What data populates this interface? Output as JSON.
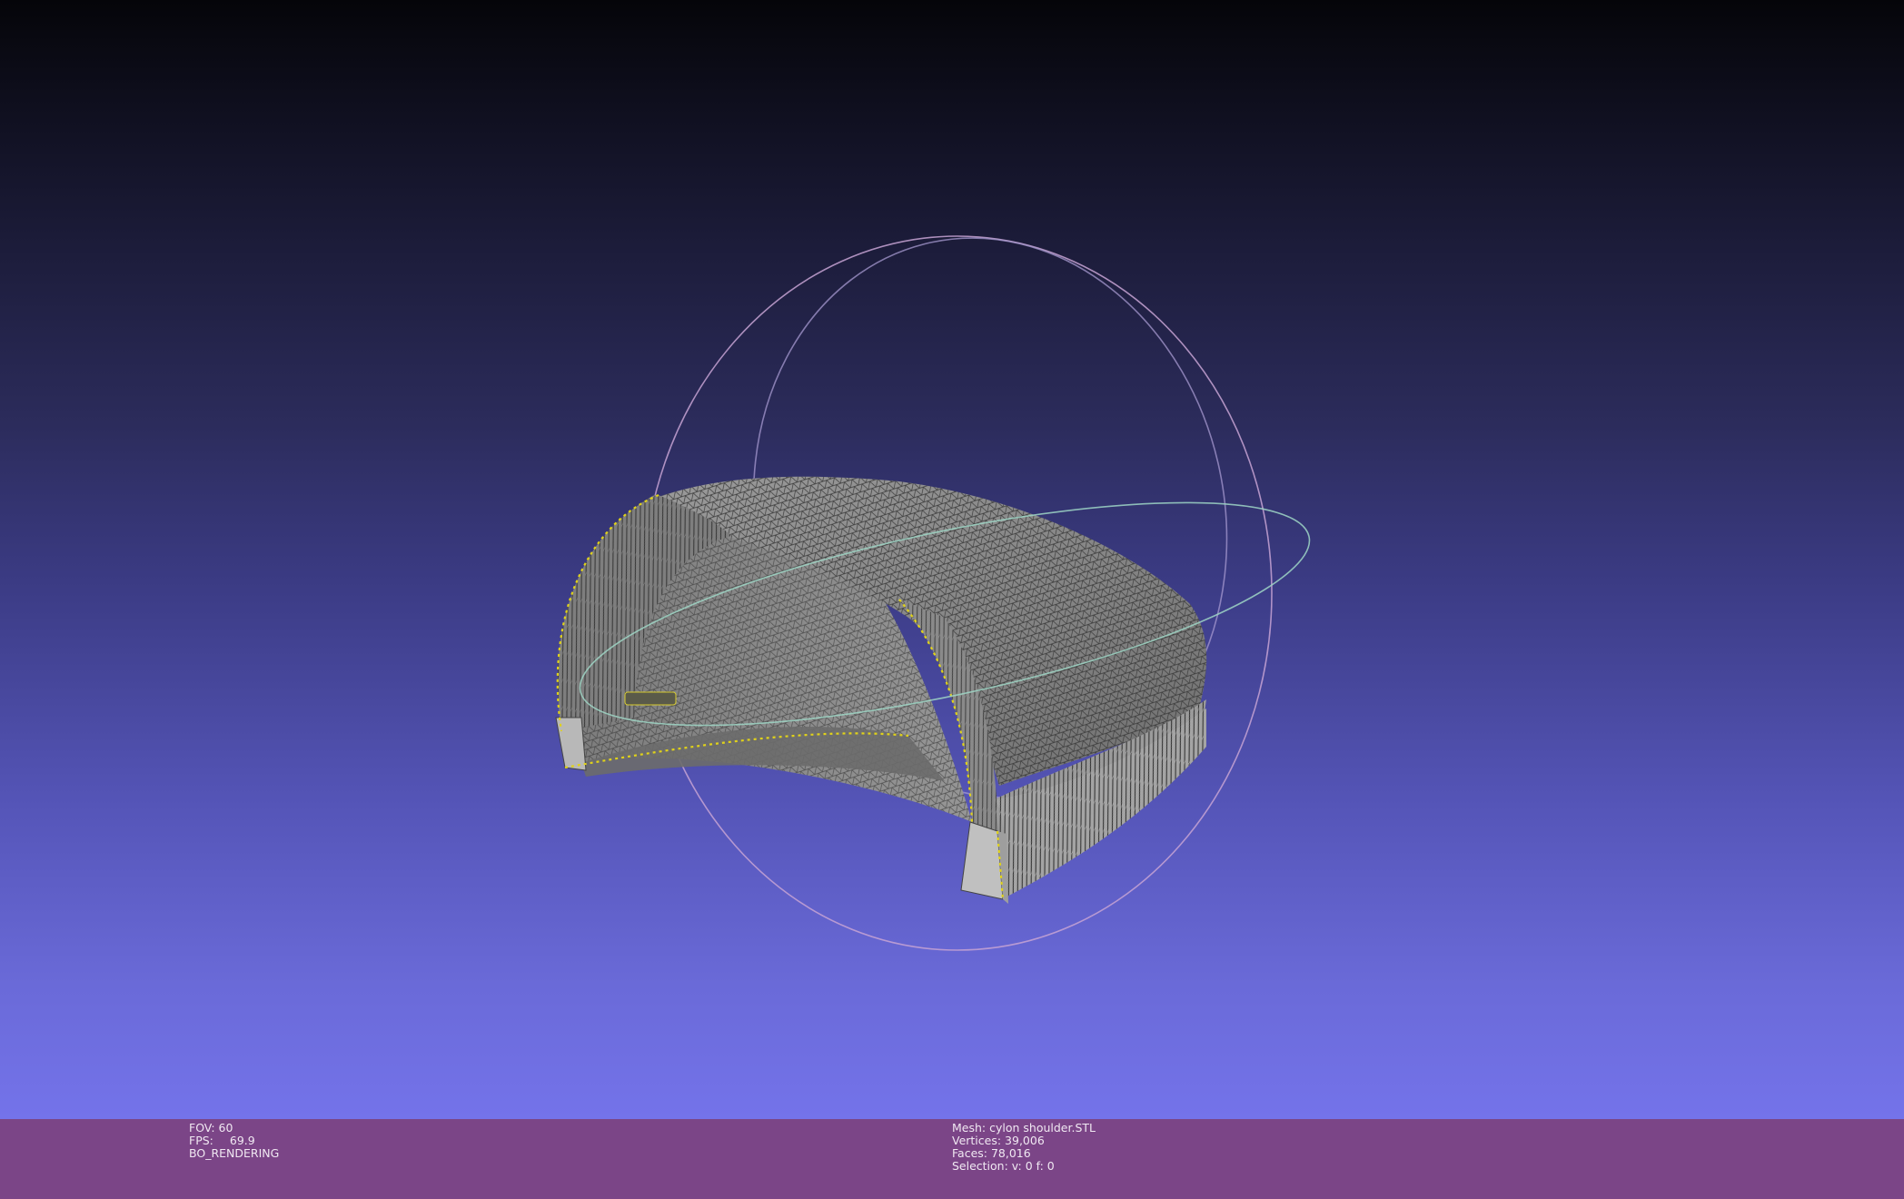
{
  "viewer": {
    "colors": {
      "background_top": "#050509",
      "background_bottom": "#7473ea",
      "info_bar": "#7b4587",
      "mesh_fill": "#8c8c8c",
      "mesh_wire": "#3b3b3b",
      "border_edges": "#e6d81a",
      "trackball_x": "#b0a8e0",
      "trackball_y": "#e0a8d8",
      "trackball_z": "#a8e0c8"
    },
    "icons": [
      "trackball-gizmo",
      "mesh-model"
    ]
  },
  "info_left": {
    "fov_label": "FOV:",
    "fov_value": "60",
    "fps_label": "FPS:",
    "fps_value": "69.9",
    "render_mode": "BO_RENDERING"
  },
  "info_right": {
    "mesh_line": "Mesh: cylon shoulder.STL",
    "vertices_line": "Vertices: 39,006",
    "faces_line": "Faces: 78,016",
    "selection_line": "Selection: v: 0 f: 0"
  }
}
